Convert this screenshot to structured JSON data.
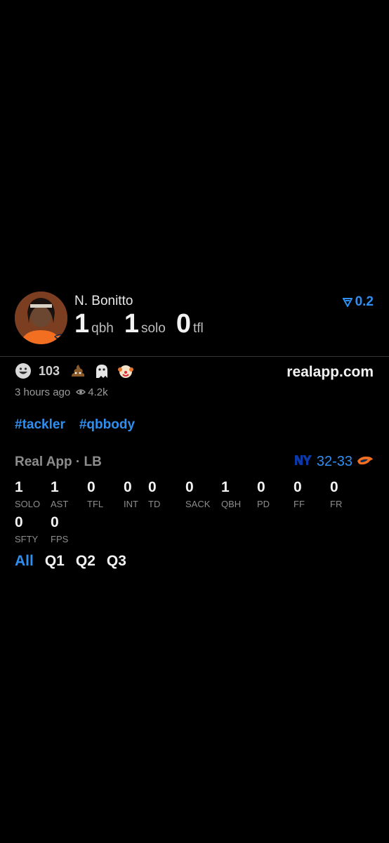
{
  "player": {
    "name": "N. Bonitto",
    "avatar": "player-photo",
    "value": "0.2",
    "headline_stats": [
      {
        "value": "1",
        "label": "qbh"
      },
      {
        "value": "1",
        "label": "solo"
      },
      {
        "value": "0",
        "label": "tfl"
      }
    ]
  },
  "reactions": [
    {
      "icon": "grinning-face-emoji",
      "count": "103"
    },
    {
      "icon": "poop-emoji",
      "count": ""
    },
    {
      "icon": "ghost-emoji",
      "count": ""
    },
    {
      "icon": "clown-emoji",
      "count": ""
    }
  ],
  "site": "realapp.com",
  "meta": {
    "time": "3 hours ago",
    "views": "4.2k"
  },
  "tags": [
    "#tackler",
    "#qbbody"
  ],
  "game": {
    "source": "Real App · LB",
    "score": "32-33",
    "highlight": "33",
    "teams": [
      "ny-logo",
      "broncos-logo"
    ]
  },
  "stats": [
    {
      "value": "1",
      "label": "SOLO"
    },
    {
      "value": "1",
      "label": "AST"
    },
    {
      "value": "0",
      "label": "TFL"
    },
    {
      "value": "0",
      "label": "INT"
    },
    {
      "value": "0",
      "label": "TD"
    },
    {
      "value": "0",
      "label": "SACK"
    },
    {
      "value": "1",
      "label": "QBH"
    },
    {
      "value": "0",
      "label": "PD"
    },
    {
      "value": "0",
      "label": "FF"
    },
    {
      "value": "0",
      "label": "FR"
    },
    {
      "value": "0",
      "label": "SFTY"
    },
    {
      "value": "0",
      "label": "FPS"
    }
  ],
  "quarters": [
    {
      "label": "All",
      "active": true
    },
    {
      "label": "Q1",
      "active": false
    },
    {
      "label": "Q2",
      "active": false
    },
    {
      "label": "Q3",
      "active": false
    }
  ],
  "colors": {
    "accent": "#2f8ff0",
    "bg": "#000000"
  }
}
